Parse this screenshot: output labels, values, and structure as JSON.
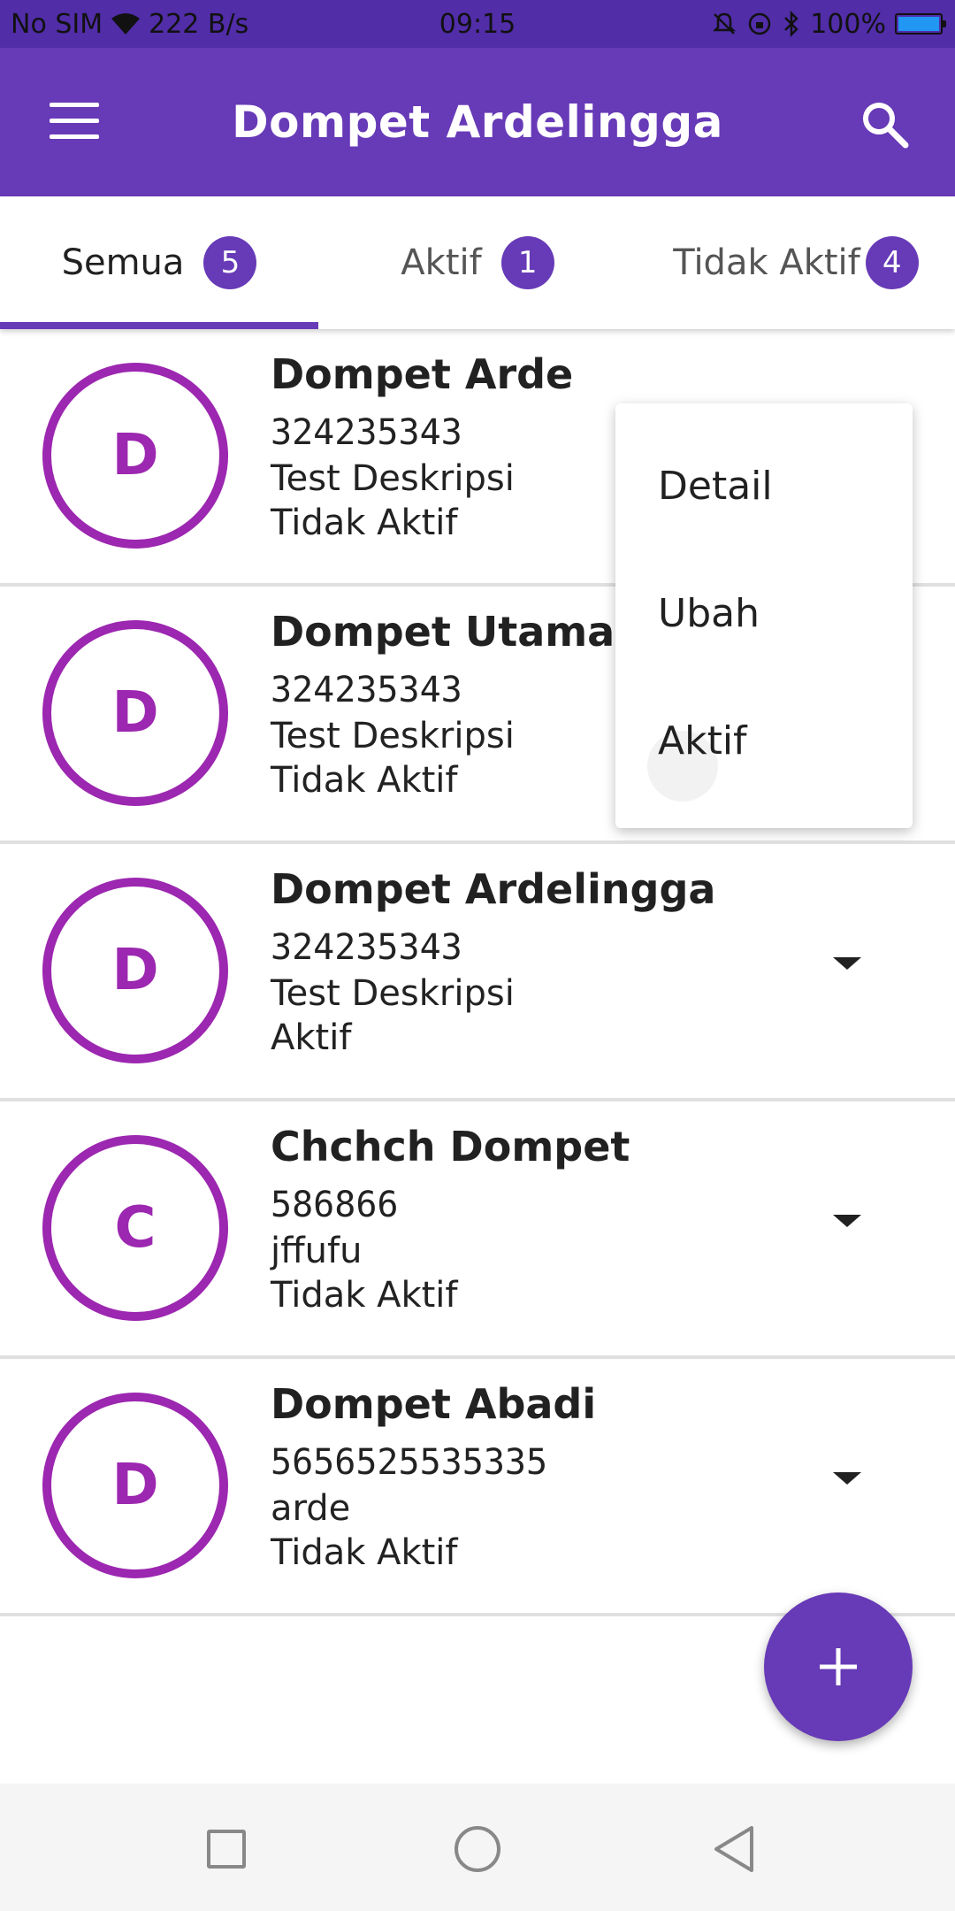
{
  "status_bar": {
    "carrier": "No SIM",
    "speed": "222 B/s",
    "time": "09:15",
    "battery": "100%"
  },
  "app_bar": {
    "title": "Dompet Ardelingga"
  },
  "tabs": [
    {
      "label": "Semua",
      "count": "5"
    },
    {
      "label": "Aktif",
      "count": "1"
    },
    {
      "label": "Tidak Aktif",
      "count": "4"
    }
  ],
  "wallets": [
    {
      "initial": "D",
      "name": "Dompet Arde",
      "number": "324235343",
      "description": "Test Deskripsi",
      "status": "Tidak  Aktif"
    },
    {
      "initial": "D",
      "name": "Dompet Utama",
      "number": "324235343",
      "description": "Test Deskripsi",
      "status": "Tidak  Aktif"
    },
    {
      "initial": "D",
      "name": "Dompet Ardelingga",
      "number": "324235343",
      "description": "Test Deskripsi",
      "status": "Aktif"
    },
    {
      "initial": "C",
      "name": "Chchch Dompet",
      "number": "586866",
      "description": "jffufu",
      "status": "Tidak  Aktif"
    },
    {
      "initial": "D",
      "name": "Dompet Abadi",
      "number": "5656525535335",
      "description": "arde",
      "status": "Tidak  Aktif"
    }
  ],
  "popup_menu": {
    "items": [
      "Detail",
      "Ubah",
      "Aktif"
    ]
  },
  "fab": {
    "label": "+"
  },
  "colors": {
    "primary": "#673ab7",
    "primary_dark": "#512da8",
    "avatar_ring": "#9c27b0"
  },
  "icons": {
    "menu": "hamburger-menu-icon",
    "search": "search-icon",
    "wifi": "wifi-icon",
    "bluetooth": "bluetooth-icon",
    "dropdown": "caret-down-icon",
    "add": "plus-icon"
  }
}
